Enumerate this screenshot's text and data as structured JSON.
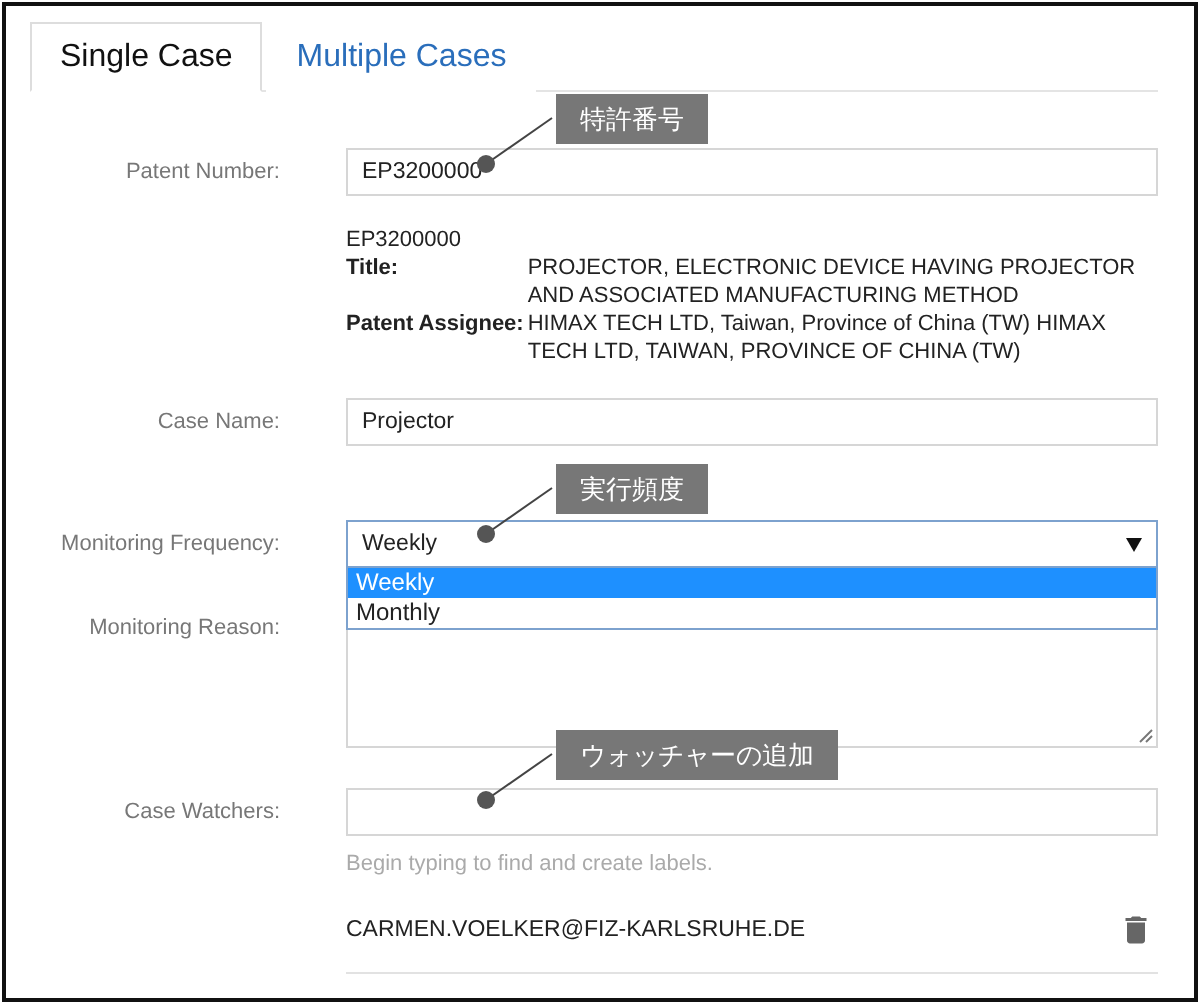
{
  "tabs": [
    {
      "label": "Single Case",
      "selected": true
    },
    {
      "label": "Multiple Cases",
      "selected": false
    }
  ],
  "patent_number": {
    "label": "Patent Number:",
    "value": "EP3200000",
    "callout": "特許番号"
  },
  "patent_info": {
    "number": "EP3200000",
    "fields": [
      {
        "label": "Title:",
        "value": "PROJECTOR, ELECTRONIC DEVICE HAVING PROJECTOR AND ASSOCIATED MANUFACTURING METHOD"
      },
      {
        "label": "Patent Assignee:",
        "value": "HIMAX TECH LTD, Taiwan, Province of China (TW) HIMAX TECH LTD, TAIWAN, PROVINCE OF CHINA (TW)"
      }
    ]
  },
  "case_name": {
    "label": "Case Name:",
    "value": "Projector"
  },
  "monitoring_frequency": {
    "label": "Monitoring Frequency:",
    "value": "Weekly",
    "expanded": true,
    "callout": "実行頻度",
    "options": [
      {
        "label": "Weekly",
        "selected": true
      },
      {
        "label": "Monthly",
        "selected": false
      }
    ]
  },
  "monitoring_reason": {
    "label": "Monitoring Reason:"
  },
  "case_watchers": {
    "label": "Case Watchers:",
    "hint": "Begin typing to find and create labels.",
    "callout": "ウォッチャーの追加"
  },
  "watchers": [
    {
      "email": "CARMEN.VOELKER@FIZ-KARLSRUHE.DE"
    }
  ]
}
